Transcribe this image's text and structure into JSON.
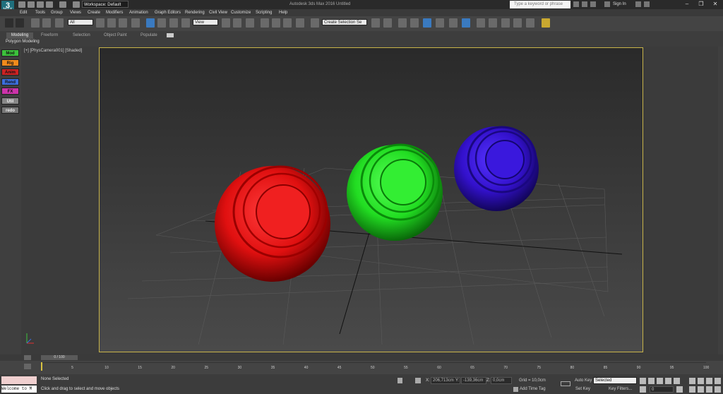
{
  "titlebar": {
    "logo_text": "MAX",
    "workspace": "Workspace: Default",
    "window_title": "Autodesk 3ds Max 2016    Untitled",
    "search_placeholder": "Type a keyword or phrase",
    "signin": "Sign In",
    "window_buttons": [
      "–",
      "❐",
      "✕"
    ]
  },
  "menu": [
    "Edit",
    "Tools",
    "Group",
    "Views",
    "Create",
    "Modifiers",
    "Animation",
    "Graph Editors",
    "Rendering",
    "Civil View",
    "Customize",
    "Scripting",
    "Help"
  ],
  "toolbar": {
    "filter_value": "All",
    "view_value": "View",
    "selection_set": "Create Selection Se"
  },
  "ribbon": {
    "tabs": [
      "Modeling",
      "Freeform",
      "Selection",
      "Object Paint",
      "Populate"
    ],
    "panel_label": "Polygon Modeling"
  },
  "sidebar": [
    "Mod",
    "Rig",
    "Anim",
    "Rend",
    "FX",
    "Util",
    "redo"
  ],
  "sidebar_colors": [
    "#3cc23c",
    "#f08a1c",
    "#cc2222",
    "#3c6edc",
    "#cc33aa",
    "#888888",
    "#777777"
  ],
  "viewport": {
    "label": "[+] [PhysCamera001] [Shaded]",
    "spheres": [
      {
        "name": "red-sphere",
        "color": "#e01010"
      },
      {
        "name": "green-sphere",
        "color": "#22dd22"
      },
      {
        "name": "blue-sphere",
        "color": "#3311cc"
      }
    ]
  },
  "timeline": {
    "slider": "0 / 100",
    "ticks": [
      "5",
      "10",
      "15",
      "20",
      "25",
      "30",
      "35",
      "40",
      "45",
      "50",
      "55",
      "60",
      "65",
      "70",
      "75",
      "80",
      "85",
      "90",
      "95",
      "100"
    ]
  },
  "status": {
    "listener": "Welcome to M",
    "selection": "None Selected",
    "prompt": "Click and drag to select and move objects",
    "x_label": "X:",
    "x_value": "206,713cm",
    "y_label": "Y:",
    "y_value": "-139,36cm",
    "z_label": "Z:",
    "z_value": "0,0cm",
    "grid": "Grid = 10,0cm",
    "add_time_tag": "Add Time Tag",
    "auto_key": "Auto Key",
    "selected": "Selected",
    "set_key": "Set Key",
    "key_filters": "Key Filters...",
    "frame": "0"
  }
}
